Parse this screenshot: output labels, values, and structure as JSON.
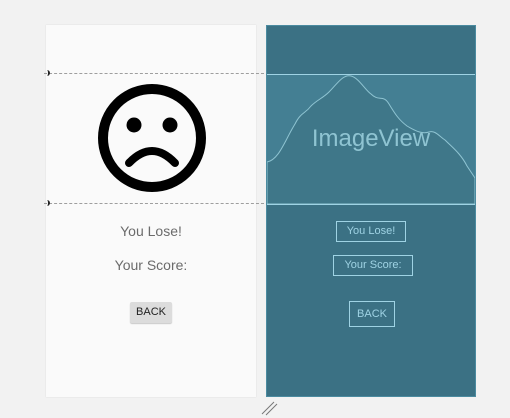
{
  "design": {
    "lose_text": "You Lose!",
    "score_text": "Your Score:",
    "back_label": "BACK",
    "face_icon": "sad-face-icon"
  },
  "blueprint": {
    "image_label": "ImageView",
    "lose_text": "You Lose!",
    "score_text": "Your Score:",
    "back_label": "BACK"
  },
  "colors": {
    "canvas": "#f2f2f2",
    "design_bg": "#fafafa",
    "blueprint_bg": "#3b7184",
    "blueprint_line": "#9fd3e4"
  }
}
